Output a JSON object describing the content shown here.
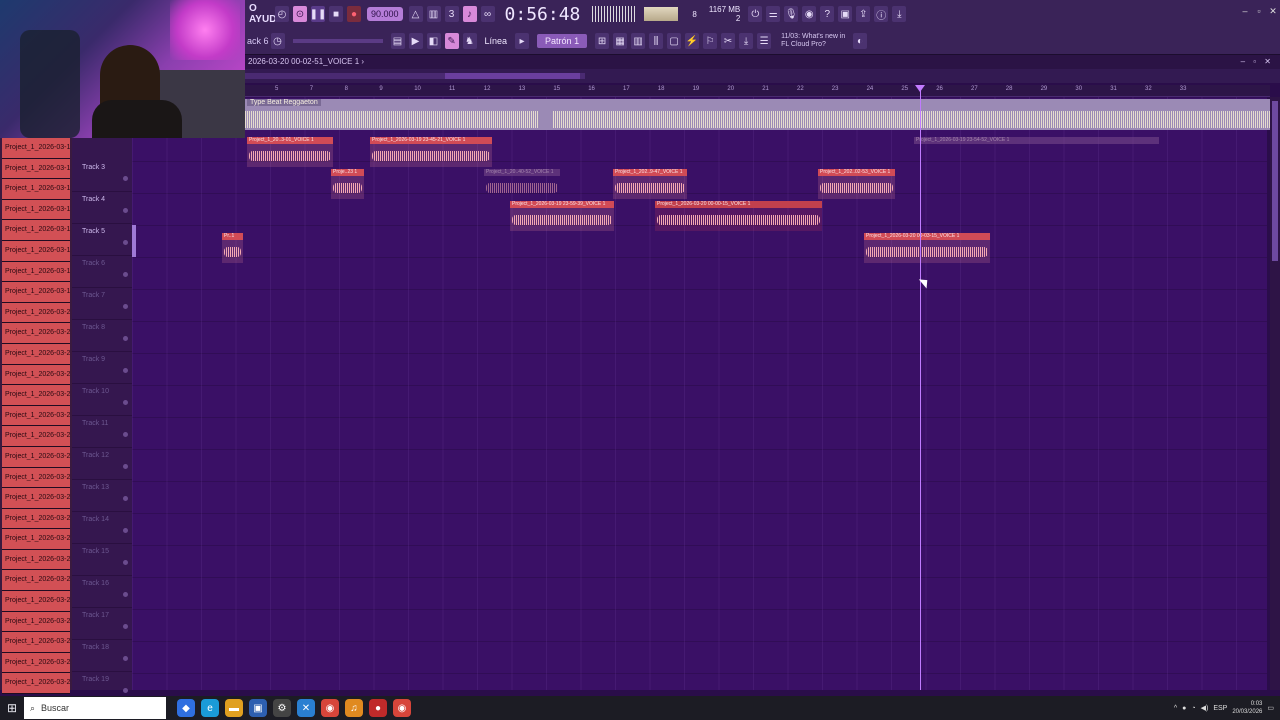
{
  "toolbar": {
    "app_name": "O AYUDA",
    "tempo": "90.000",
    "time": "0:56:48",
    "memory_top": "1167 MB",
    "memory_bottom": "2",
    "cpu_num": "8",
    "hint": "ack 6",
    "pattern": "Patrón 1",
    "line": "Línea",
    "news": "11/03: What's new in FL Cloud Pro?"
  },
  "playlist": {
    "title": "2026-03-20 00-02-51_VOICE 1 ›"
  },
  "ruler": [
    "5",
    "7",
    "8",
    "9",
    "10",
    "11",
    "12",
    "13",
    "15",
    "16",
    "17",
    "18",
    "19",
    "20",
    "21",
    "22",
    "23",
    "24",
    "25",
    "26",
    "27",
    "28",
    "29",
    "30",
    "31",
    "32",
    "33"
  ],
  "beat_track": {
    "label": "Type Beat Reggaeton"
  },
  "clip_bin": [
    "Project_1_2026-03-19 2",
    "Project_1_2026-03-19 2",
    "Project_1_2026-03-19 2",
    "Project_1_2026-03-19 2",
    "Project_1_2026-03-19 2",
    "Project_1_2026-03-19 2",
    "Project_1_2026-03-19 2",
    "Project_1_2026-03-19 2",
    "Project_1_2026-03-20 0",
    "Project_1_2026-03-20 0",
    "Project_1_2026-03-20 0",
    "Project_1_2026-03-20 0",
    "Project_1_2026-03-20 0",
    "Project_1_2026-03-20 0",
    "Project_1_2026-03-20 0",
    "Project_1_2026-03-20 0",
    "Project_1_2026-03-20 0",
    "Project_1_2026-03-20 0",
    "Project_1_2026-03-20 0",
    "Project_1_2026-03-20 0",
    "Project_1_2026-03-20 0",
    "Project_1_2026-03-20 0",
    "Project_1_2026-03-20 0",
    "Project_1_2026-03-20 0",
    "Project_1_2026-03-20 0",
    "Project_1_2026-03-20 0",
    "Project_1_2026-03-20 0"
  ],
  "tracks": [
    "Track 3",
    "Track 4",
    "Track 5",
    "Track 6",
    "Track 7",
    "Track 8",
    "Track 9",
    "Track 10",
    "Track 11",
    "Track 12",
    "Track 13",
    "Track 14",
    "Track 15",
    "Track 16",
    "Track 17",
    "Track 18",
    "Track 19"
  ],
  "clips": {
    "c1": "Project_1_20..3-01_VOICE 1",
    "c2": "Project_1_2026-03-19 23-45-21_VOICE 1",
    "c3": "Project_1_2026-03-19 23-54-52_VOICE 1",
    "c4": "Proje..23 1",
    "c5": "Project_1_20..40-52_VOICE 1",
    "c6": "Project_1_202..9-47_VOICE 1",
    "c7": "Project_1_202..02-53_VOICE 1",
    "c8": "Project_1_2026-03-19 23-59-39_VOICE 1",
    "c9": "Project_1_2026-03-20 00-00-15_VOICE 1",
    "c10": "Pr..1",
    "c11": "Project_1_2026-03-20 00-03-15_VOICE 1"
  },
  "taskbar": {
    "search": "Buscar",
    "lang": "ESP",
    "time": "0:03",
    "date": "20/03/2026"
  }
}
